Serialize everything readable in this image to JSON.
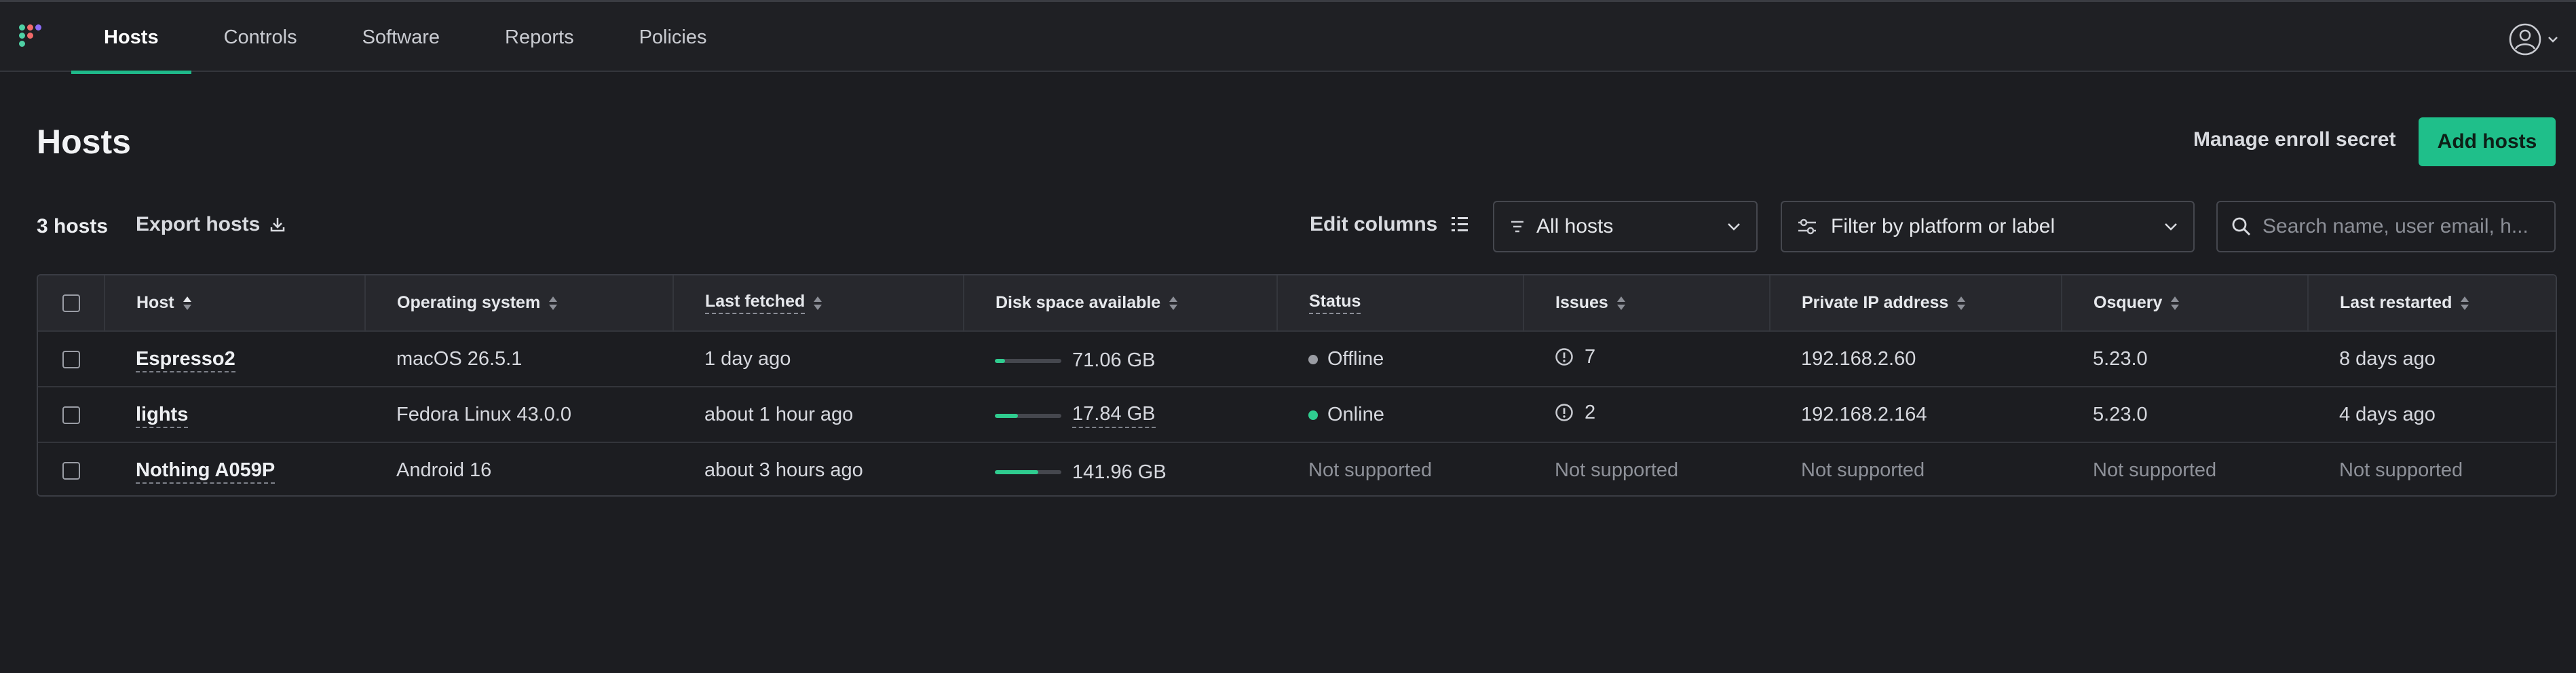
{
  "nav": {
    "tabs": [
      {
        "label": "Hosts",
        "active": true
      },
      {
        "label": "Controls",
        "active": false
      },
      {
        "label": "Software",
        "active": false
      },
      {
        "label": "Reports",
        "active": false
      },
      {
        "label": "Policies",
        "active": false
      }
    ],
    "user_icon": "user-circle-icon"
  },
  "header": {
    "title": "Hosts",
    "manage_secret_label": "Manage enroll secret",
    "add_hosts_label": "Add hosts"
  },
  "toolbar": {
    "host_count": "3 hosts",
    "export_label": "Export hosts",
    "edit_columns_label": "Edit columns",
    "status_select_value": "All hosts",
    "filter_select_value": "Filter by platform or label",
    "search_placeholder": "Search name, user email, h..."
  },
  "table": {
    "columns": [
      "Host",
      "Operating system",
      "Last fetched",
      "Disk space available",
      "Status",
      "Issues",
      "Private IP address",
      "Osquery",
      "Last restarted"
    ],
    "rows": [
      {
        "host": "Espresso2",
        "os": "macOS 26.5.1",
        "last_fetched": "1 day ago",
        "disk_value": "71.06 GB",
        "disk_fraction": 0.15,
        "status": "Offline",
        "status_color": "#9a9ca3",
        "issues": "7",
        "ip": "192.168.2.60",
        "osquery": "5.23.0",
        "last_restarted": "8 days ago"
      },
      {
        "host": "lights",
        "os": "Fedora Linux 43.0.0",
        "last_fetched": "about 1 hour ago",
        "disk_value": "17.84 GB",
        "disk_fraction": 0.35,
        "status": "Online",
        "status_color": "#2fcc8f",
        "issues": "2",
        "ip": "192.168.2.164",
        "osquery": "5.23.0",
        "last_restarted": "4 days ago"
      },
      {
        "host": "Nothing A059P",
        "os": "Android 16",
        "last_fetched": "about 3 hours ago",
        "disk_value": "141.96 GB",
        "disk_fraction": 0.65,
        "status": "Not supported",
        "issues": "Not supported",
        "ip": "Not supported",
        "osquery": "Not supported",
        "last_restarted": "Not supported"
      }
    ]
  },
  "colors": {
    "accent": "#1fbf8a",
    "background": "#1c1d21"
  }
}
